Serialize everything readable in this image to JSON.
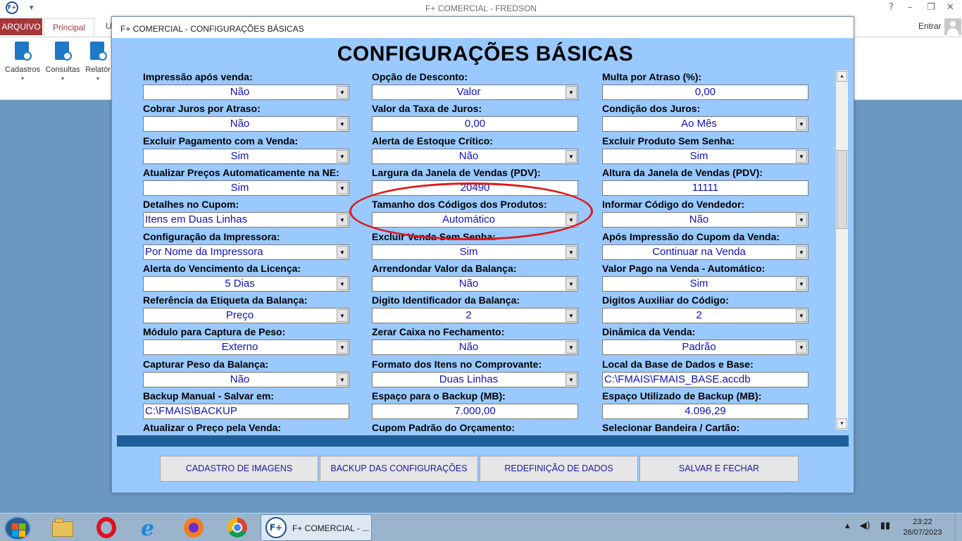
{
  "app_title": "F+ COMERCIAL - FREDSON",
  "app_icon": "F+",
  "window_controls": [
    "?",
    "–",
    "❐",
    "✕"
  ],
  "ribbon_tabs": [
    "ARQUIVO",
    "Principal",
    "U"
  ],
  "signin": "Entrar",
  "ribbon_buttons": [
    {
      "label": "Cadastros",
      "icon": "cadastros-icon"
    },
    {
      "label": "Consultas",
      "icon": "consultas-icon"
    },
    {
      "label": "Relatór",
      "icon": "relatorios-icon"
    }
  ],
  "dialog": {
    "title": "F+ COMERCIAL - CONFIGURAÇÕES BÁSICAS",
    "heading": "CONFIGURAÇÕES BÁSICAS"
  },
  "fields": [
    {
      "label": "Impressão após venda:",
      "value": "Não",
      "dropdown": true,
      "align": "center"
    },
    {
      "label": "Opção de Desconto:",
      "value": "Valor",
      "dropdown": true,
      "align": "center"
    },
    {
      "label": "Multa por Atraso (%):",
      "value": "0,00",
      "dropdown": false,
      "align": "center"
    },
    {
      "label": "Cobrar Juros por Atraso:",
      "value": "Não",
      "dropdown": true,
      "align": "center"
    },
    {
      "label": "Valor da Taxa de Juros:",
      "value": "0,00",
      "dropdown": false,
      "align": "center"
    },
    {
      "label": "Condição dos Juros:",
      "value": "Ao Mês",
      "dropdown": true,
      "align": "center"
    },
    {
      "label": "Excluir Pagamento com a Venda:",
      "value": "Sim",
      "dropdown": true,
      "align": "center"
    },
    {
      "label": "Alerta de Estoque Crítico:",
      "value": "Não",
      "dropdown": true,
      "align": "center"
    },
    {
      "label": "Excluir Produto Sem Senha:",
      "value": "Sim",
      "dropdown": true,
      "align": "center"
    },
    {
      "label": "Atualizar Preços Automaticamente na NE:",
      "value": "Sim",
      "dropdown": true,
      "align": "center"
    },
    {
      "label": "Largura da Janela de Vendas (PDV):",
      "value": "20490",
      "dropdown": false,
      "align": "center"
    },
    {
      "label": "Altura da Janela de Vendas (PDV):",
      "value": "11111",
      "dropdown": false,
      "align": "center"
    },
    {
      "label": "Detalhes no Cupom:",
      "value": "Itens em Duas Linhas",
      "dropdown": true,
      "align": "left"
    },
    {
      "label": "Tamanho dos Códigos dos Produtos:",
      "value": "Automático",
      "dropdown": true,
      "align": "center"
    },
    {
      "label": "Informar Código do Vendedor:",
      "value": "Não",
      "dropdown": true,
      "align": "center"
    },
    {
      "label": "Configuração da Impressora:",
      "value": "Por Nome da Impressora",
      "dropdown": true,
      "align": "left"
    },
    {
      "label": "Excluir Venda Sem Senha:",
      "value": "Sim",
      "dropdown": true,
      "align": "center"
    },
    {
      "label": "Após Impressão do Cupom da Venda:",
      "value": "Continuar na Venda",
      "dropdown": true,
      "align": "center"
    },
    {
      "label": "Alerta do Vencimento da Licença:",
      "value": "5 Dias",
      "dropdown": true,
      "align": "center"
    },
    {
      "label": "Arrendondar Valor da Balança:",
      "value": "Não",
      "dropdown": true,
      "align": "center"
    },
    {
      "label": "Valor Pago na Venda - Automático:",
      "value": "Sim",
      "dropdown": true,
      "align": "center"
    },
    {
      "label": "Referência da Etiqueta da Balança:",
      "value": "Preço",
      "dropdown": true,
      "align": "center"
    },
    {
      "label": "Digito Identificador da Balança:",
      "value": "2",
      "dropdown": true,
      "align": "center"
    },
    {
      "label": "Digitos Auxiliar do Código:",
      "value": "2",
      "dropdown": true,
      "align": "center"
    },
    {
      "label": "Módulo para Captura de Peso:",
      "value": "Externo",
      "dropdown": true,
      "align": "center"
    },
    {
      "label": "Zerar Caixa no Fechamento:",
      "value": "Não",
      "dropdown": true,
      "align": "center"
    },
    {
      "label": "Dinâmica da Venda:",
      "value": "Padrão",
      "dropdown": true,
      "align": "center"
    },
    {
      "label": "Capturar Peso da Balança:",
      "value": "Não",
      "dropdown": true,
      "align": "center"
    },
    {
      "label": "Formato dos Itens no Comprovante:",
      "value": "Duas Linhas",
      "dropdown": true,
      "align": "center"
    },
    {
      "label": "Local da Base de Dados e Base:",
      "value": "C:\\FMAIS\\FMAIS_BASE.accdb",
      "dropdown": false,
      "align": "left"
    },
    {
      "label": "Backup Manual - Salvar em:",
      "value": "C:\\FMAIS\\BACKUP",
      "dropdown": false,
      "align": "left"
    },
    {
      "label": "Espaço para o Backup (MB):",
      "value": "7.000,00",
      "dropdown": false,
      "align": "center"
    },
    {
      "label": "Espaço Utilizado de Backup (MB):",
      "value": "4.096,29",
      "dropdown": false,
      "align": "center"
    },
    {
      "label": "Atualizar o Preço pela Venda:",
      "value": "",
      "dropdown": true,
      "align": "center"
    },
    {
      "label": "Cupom Padrão do Orçamento:",
      "value": "",
      "dropdown": true,
      "align": "center"
    },
    {
      "label": "Selecionar Bandeira / Cartão:",
      "value": "",
      "dropdown": true,
      "align": "center"
    }
  ],
  "actions": {
    "cadastro_imagens": "CADASTRO DE IMAGENS",
    "backup_config": "BACKUP DAS CONFIGURAÇÕES",
    "redefinicao": "REDEFINIÇÃO DE DADOS",
    "salvar_fechar": "SALVAR E FECHAR"
  },
  "taskbar": {
    "apps": [
      "file-explorer-icon",
      "opera-icon",
      "internet-explorer-icon",
      "firefox-icon",
      "chrome-icon"
    ],
    "active_task": "F+ COMERCIAL - ...",
    "active_task_icon": "F+",
    "time": "23:22",
    "date": "26/07/2023"
  },
  "colors": {
    "dialog_bg": "#99c9ff",
    "value_text": "#1010c0",
    "accent_bar": "#1f5f99",
    "highlight_circle": "#dc1a1a",
    "ribbon_file_tab": "#a4373a"
  }
}
